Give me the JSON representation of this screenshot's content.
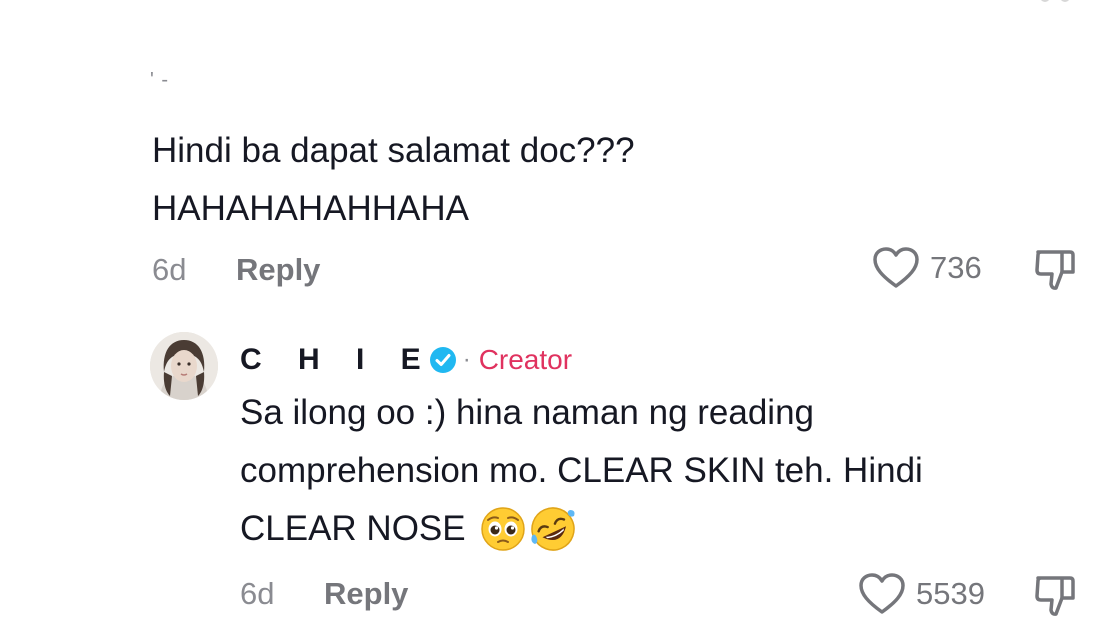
{
  "comments": [
    {
      "username_fragment": "' -",
      "text_line1": "Hindi ba dapat salamat doc???",
      "text_line2": "HAHAHAHAHHAHA",
      "time": "6d",
      "reply_label": "Reply",
      "likes": "736"
    },
    {
      "author": "C H I E",
      "author_tag": "Creator",
      "separator": "·",
      "text_line1": "Sa ilong oo :) hina naman ng reading",
      "text_line2": "comprehension mo. CLEAR SKIN teh. Hindi",
      "text_line3": "CLEAR NOSE",
      "time": "6d",
      "reply_label": "Reply",
      "likes": "5539"
    }
  ],
  "icons": {
    "like": "heart-outline-icon",
    "dislike": "thumbs-down-icon",
    "verified": "verified-badge-icon",
    "emoji1": "pleading-face-emoji-icon",
    "emoji2": "rolling-laughing-emoji-icon"
  },
  "colors": {
    "text": "#161823",
    "muted": "#8a8b91",
    "creator_tag": "#e0325f",
    "verified": "#20b8f1"
  }
}
